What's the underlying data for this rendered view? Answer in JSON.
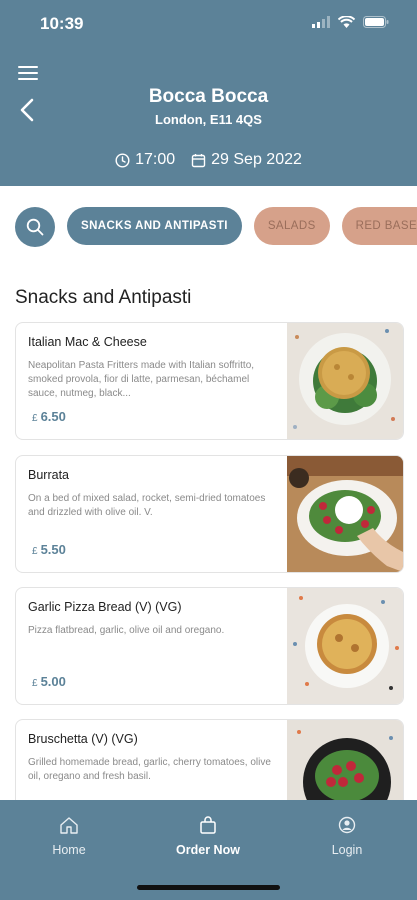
{
  "status_bar": {
    "time": "10:39"
  },
  "header": {
    "restaurant_name": "Bocca Bocca",
    "address": "London, E11 4QS",
    "time": "17:00",
    "date": "29 Sep 2022"
  },
  "categories": [
    {
      "label": "SNACKS AND ANTIPASTI",
      "active": true
    },
    {
      "label": "SALADS",
      "active": false
    },
    {
      "label": "RED BASE PIZZA",
      "active": false
    }
  ],
  "section_title": "Snacks and Antipasti",
  "items": [
    {
      "name": "Italian Mac & Cheese",
      "description": "Neapolitan Pasta Fritters made with Italian soffritto, smoked provola, fior di latte, parmesan, béchamel sauce, nutmeg, black...",
      "currency": "£",
      "price": "6.50"
    },
    {
      "name": "Burrata",
      "description": "On a bed of mixed salad, rocket, semi-dried tomatoes and drizzled with olive oil. V.",
      "currency": "£",
      "price": "5.50"
    },
    {
      "name": "Garlic Pizza Bread (V) (VG)",
      "description": "Pizza flatbread, garlic, olive oil and oregano.",
      "currency": "£",
      "price": "5.00"
    },
    {
      "name": "Bruschetta (V) (VG)",
      "description": "Grilled homemade bread, garlic, cherry tomatoes, olive oil, oregano and fresh basil.",
      "currency": "£",
      "price": ""
    }
  ],
  "bottom_nav": [
    {
      "label": "Home",
      "icon": "home-icon"
    },
    {
      "label": "Order Now",
      "icon": "bag-icon"
    },
    {
      "label": "Login",
      "icon": "user-icon"
    }
  ],
  "colors": {
    "primary": "#5c8298",
    "accent": "#d6a18a"
  }
}
